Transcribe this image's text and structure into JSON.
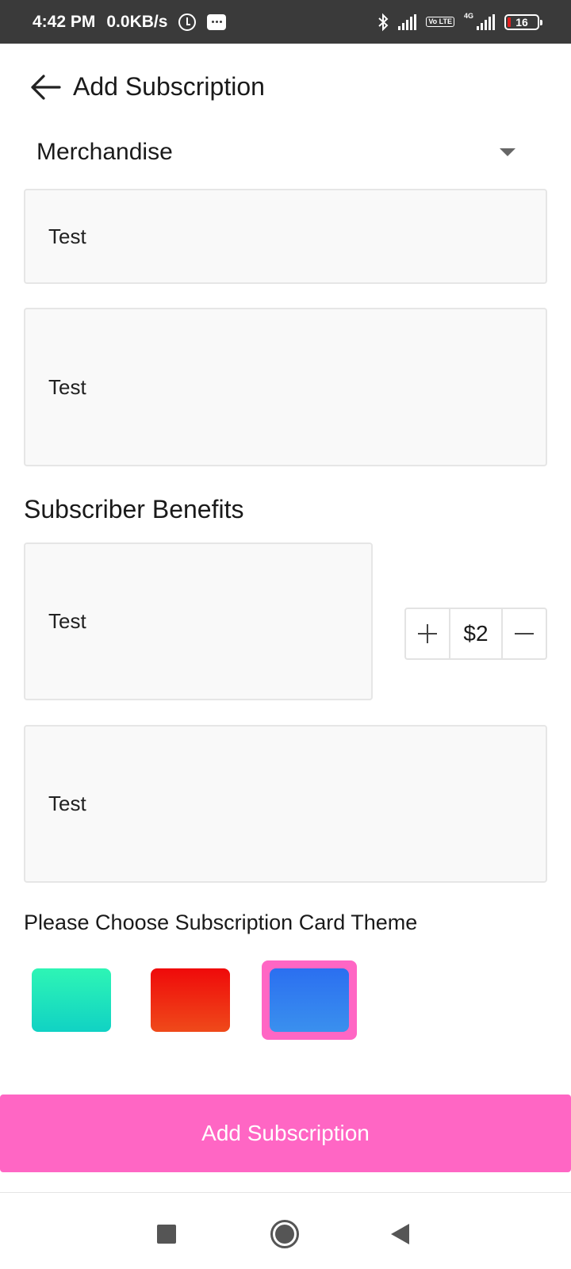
{
  "status_bar": {
    "time": "4:42 PM",
    "network_speed": "0.0KB/s",
    "battery_level": "16",
    "network_type": "4G",
    "volte": "Vo LTE",
    "icons": [
      "alarm-icon",
      "message-icon",
      "bluetooth-icon",
      "signal-icon",
      "volte-icon",
      "signal-4g-icon",
      "battery-icon"
    ]
  },
  "header": {
    "title": "Add Subscription",
    "back_icon": "arrow-left-icon"
  },
  "form": {
    "category": "Merchandise",
    "field_1_value": "Test",
    "field_2_value": "Test",
    "benefits_title": "Subscriber Benefits",
    "benefit_1_value": "Test",
    "price_value": "$2",
    "benefit_2_value": "Test",
    "theme_label": "Please Choose Subscription Card Theme",
    "themes": [
      {
        "name": "teal",
        "colors": [
          "#2ef5b5",
          "#10d2c4"
        ]
      },
      {
        "name": "red",
        "colors": [
          "#ef0a0a",
          "#ef4a1a"
        ]
      },
      {
        "name": "blue",
        "colors": [
          "#2b6ff0",
          "#3a90ee"
        ],
        "selected": true
      }
    ],
    "selected_theme_border_color": "#ff66c4",
    "submit_label": "Add Subscription",
    "accent_color": "#ff66c4"
  },
  "nav_bar": {
    "icons": [
      "recents-icon",
      "home-icon",
      "back-icon"
    ]
  }
}
